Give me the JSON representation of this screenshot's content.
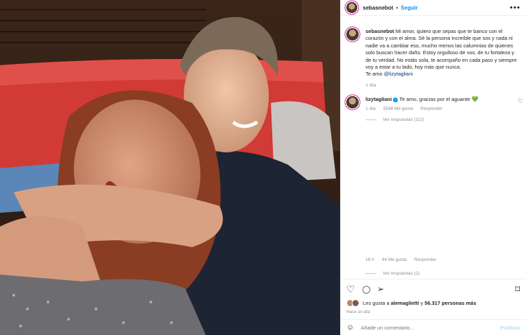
{
  "post": {
    "username": "sebasnebot",
    "separator": "•",
    "follow_label": "Seguir",
    "more_label": "•••"
  },
  "caption": {
    "username": "sebasnebot",
    "text": "Mi amor, quiero que sepas que te banco con el corazón y con el alma. Sé la persona increíble que sos y nada ni nadie va a cambiar eso, mucho menos las calumnias de quienes solo buscan hacer daño. Estoy orgulloso de vos, de tu fortaleza y de tu verdad. No estás sola, te acompaño en cada paso y siempre voy a estar a tu lado, hoy más que nunca.",
    "closing": "Te amo ",
    "mention": "@lizytagliani",
    "time": "1 día"
  },
  "comment": {
    "username": "lizytagliani",
    "verified_glyph": "✓",
    "text": "Te amo, gracias por el aguante",
    "heart": "💚",
    "time": "1 día",
    "likes": "2548 Me gusta",
    "reply": "Responder",
    "view_replies": "Ver respuestas (112)"
  },
  "sub": {
    "time": "18 h",
    "likes": "44 Me gusta",
    "reply": "Responder",
    "view_replies": "Ver respuestas (2)"
  },
  "icons": {
    "like": "♡",
    "comment": "◯",
    "share": "➢",
    "save": "⌑",
    "emoji": "☺",
    "comment_like": "♡"
  },
  "likes": {
    "prefix": "Les gusta a ",
    "user": "alemaglietti",
    "middle": " y ",
    "count": "56.317 personas más"
  },
  "timestamp": "Hace un día",
  "add_comment": {
    "placeholder": "Añade un comentario...",
    "publish": "Publicar"
  },
  "colors": {
    "accent": "#0095f6",
    "muted": "#8e8e8e",
    "publish_disabled": "#b2dffc"
  }
}
